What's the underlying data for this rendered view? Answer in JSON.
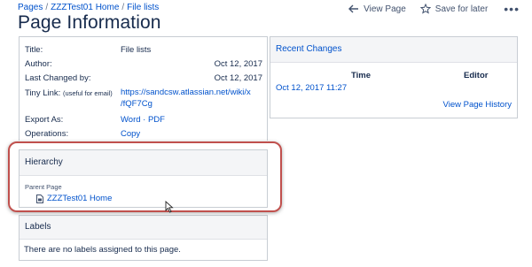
{
  "breadcrumb": {
    "items": [
      "Pages",
      "ZZZTest01 Home",
      "File lists"
    ],
    "separator": "/"
  },
  "header": {
    "view_page": "View Page",
    "save_for_later": "Save for later",
    "more": "•••"
  },
  "page_title": "Page Information",
  "info": {
    "title_label": "Title:",
    "title_value": "File lists",
    "author_label": "Author:",
    "author_date": "Oct 12, 2017",
    "last_changed_label": "Last Changed by:",
    "last_changed_date": "Oct 12, 2017",
    "tiny_link_label": "Tiny Link:",
    "tiny_link_hint": "(useful for email)",
    "tiny_link_line1": "https://sandcsw.atlassian.net/wiki/x",
    "tiny_link_line2": "/fQF7Cg",
    "export_label": "Export As:",
    "export_value": "Word · PDF",
    "operations_label": "Operations:",
    "operations_value": "Copy"
  },
  "recent_changes": {
    "title": "Recent Changes",
    "col_time": "Time",
    "col_editor": "Editor",
    "row_time": "Oct 12, 2017 11:27",
    "view_history": "View Page History"
  },
  "hierarchy": {
    "title": "Hierarchy",
    "parent_label": "Parent Page",
    "parent_link": "ZZZTest01 Home"
  },
  "labels": {
    "title": "Labels",
    "empty_text": "There are no labels assigned to this page."
  },
  "colors": {
    "link": "#0052cc",
    "highlight": "#c0504d",
    "panel_header_bg": "#f4f5f7"
  }
}
